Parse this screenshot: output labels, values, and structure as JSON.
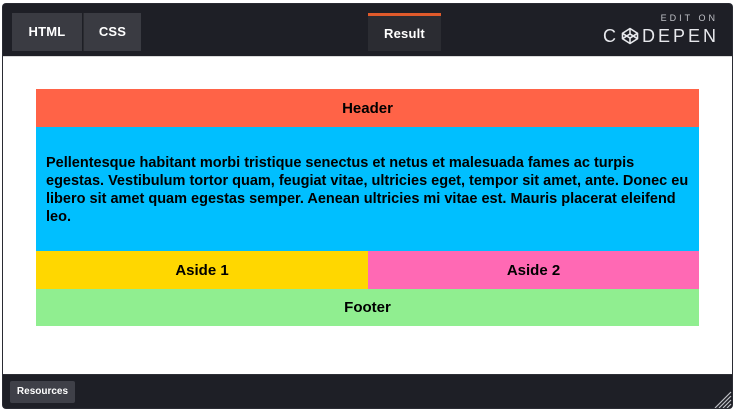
{
  "tabs": {
    "html": "HTML",
    "css": "CSS",
    "result": "Result"
  },
  "brand": {
    "edit_on": "EDIT ON",
    "name_prefix": "C",
    "name_suffix": "DEPEN",
    "logo_icon": "codepen-cube-icon"
  },
  "layout": {
    "header": "Header",
    "main": "Pellentesque habitant morbi tristique senectus et netus et malesuada fames ac turpis egestas. Vestibulum tortor quam, feugiat vitae, ultricies eget, tempor sit amet, ante. Donec eu libero sit amet quam egestas semper. Aenean ultricies mi vitae est. Mauris placerat eleifend leo.",
    "aside1": "Aside 1",
    "aside2": "Aside 2",
    "footer": "Footer"
  },
  "bottom": {
    "resources": "Resources",
    "resize_icon": "resize-grip-icon"
  },
  "colors": {
    "header": "#ff6347",
    "main": "#00bfff",
    "aside1": "#ffd700",
    "aside2": "#ff69b4",
    "footer": "#90ee90",
    "active_tab_accent": "#e05a2b"
  }
}
